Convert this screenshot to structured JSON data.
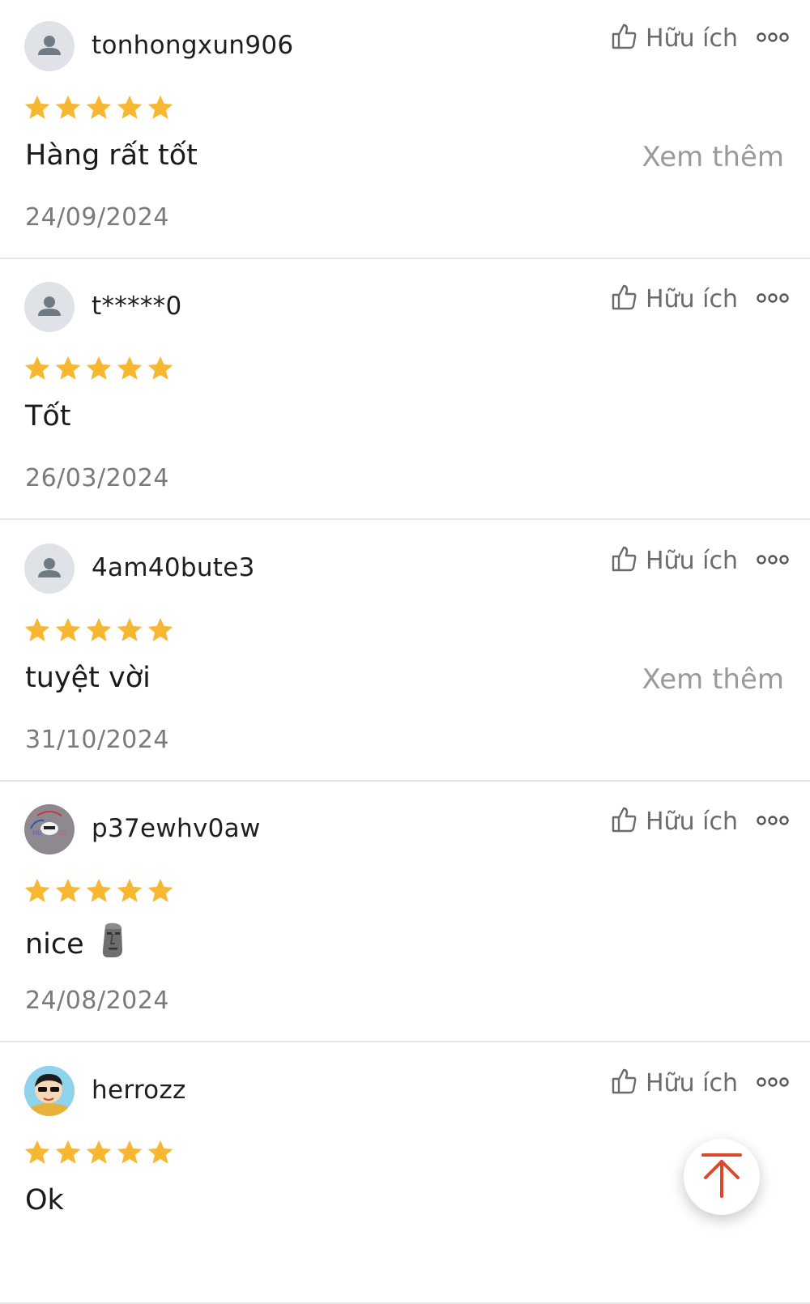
{
  "accent_star_color": "#f7b731",
  "scroll_top_color": "#d94a2b",
  "reviews": [
    {
      "username": "tonhongxun906",
      "avatar": "default-user-icon",
      "rating": 5,
      "comment": "Hàng rất tốt",
      "see_more": "Xem thêm",
      "date": "24/09/2024",
      "helpful_label": "Hữu ích"
    },
    {
      "username": "t*****0",
      "avatar": "default-user-icon",
      "rating": 5,
      "comment": "Tốt",
      "see_more": "",
      "date": "26/03/2024",
      "helpful_label": "Hữu ích"
    },
    {
      "username": "4am40bute3",
      "avatar": "default-user-icon",
      "rating": 5,
      "comment": "tuyệt vời",
      "see_more": "Xem thêm",
      "date": "31/10/2024",
      "helpful_label": "Hữu ích"
    },
    {
      "username": "p37ewhv0aw",
      "avatar": "custom-avatar-image",
      "rating": 5,
      "comment": "nice",
      "comment_emoji": "moai-emoji",
      "see_more": "",
      "date": "24/08/2024",
      "helpful_label": "Hữu ích"
    },
    {
      "username": "herrozz",
      "avatar": "cartoon-avatar-image",
      "rating": 5,
      "comment": "Ok",
      "see_more": "",
      "date": "",
      "helpful_label": "Hữu ích"
    }
  ],
  "scroll_top_icon": "arrow-up-to-top-icon"
}
